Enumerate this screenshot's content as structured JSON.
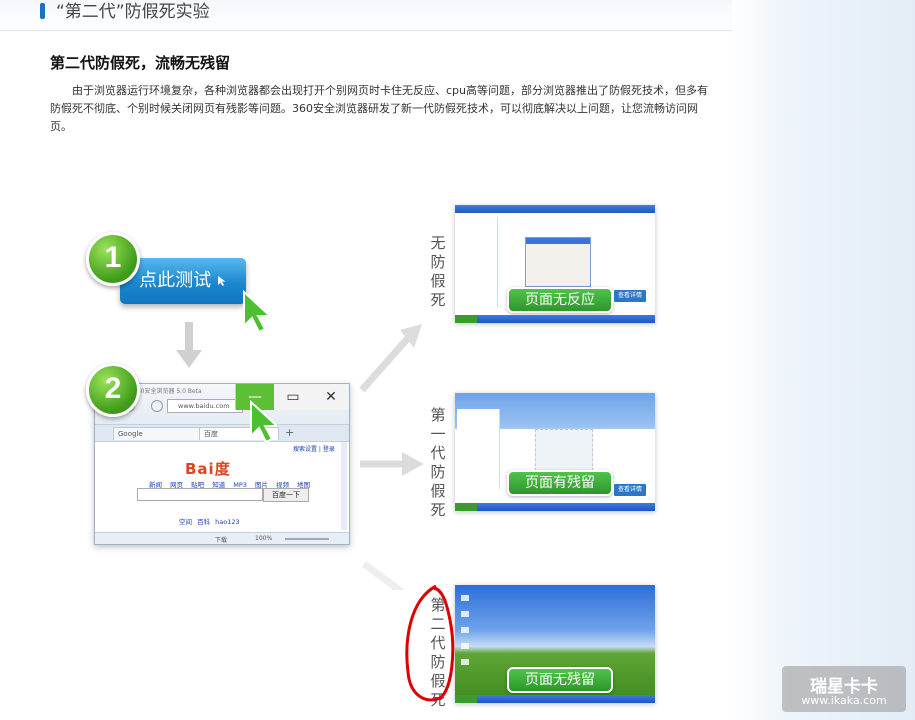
{
  "page": {
    "title": "“第二代”防假死实验",
    "heading": "第二代防假死，流畅无残留",
    "intro": "由于浏览器运行环境复杂，各种浏览器都会出现打开个别网页时卡住无反应、cpu高等问题，部分浏览器推出了防假死技术，但多有防假死不彻底、个别时候关闭网页有残影等问题。360安全浏览器研发了新一代防假死技术，可以彻底解决以上问题，让您流畅访问网页。"
  },
  "steps": {
    "step1_number": "1",
    "step2_number": "2",
    "test_button_label": "点此测试"
  },
  "browser_mock": {
    "title": "360安全浏览器 5.0 Beta",
    "url": "www.baidu.com",
    "tab1": "Google",
    "tab2": "百度",
    "win_min": "—",
    "win_max": "▭",
    "win_close": "✕",
    "logo": "Bai度",
    "nav": "新闻 网页 贴吧 知道 MP3 图片 视频 地图",
    "search_button": "百度一下",
    "links": "空间 百科 hao123",
    "top_links": "搜索设置 | 登录",
    "status_download": "下载",
    "status_zoom": "100%"
  },
  "results": [
    {
      "side_label": "无防假死",
      "badge": "页面无反应",
      "button": "查看详情"
    },
    {
      "side_label": "第一代防假死",
      "badge": "页面有残留",
      "button": "查看详情"
    },
    {
      "side_label": "第二代防假死",
      "badge": "页面无残留",
      "button": ""
    }
  ],
  "watermark": {
    "main": "瑞星卡卡",
    "url": "www.ikaka.com"
  },
  "colors": {
    "accent_blue": "#1b87cf",
    "green": "#3e9a18",
    "red_annotation": "#e00000",
    "xp_blue": "#2f6fd6"
  }
}
